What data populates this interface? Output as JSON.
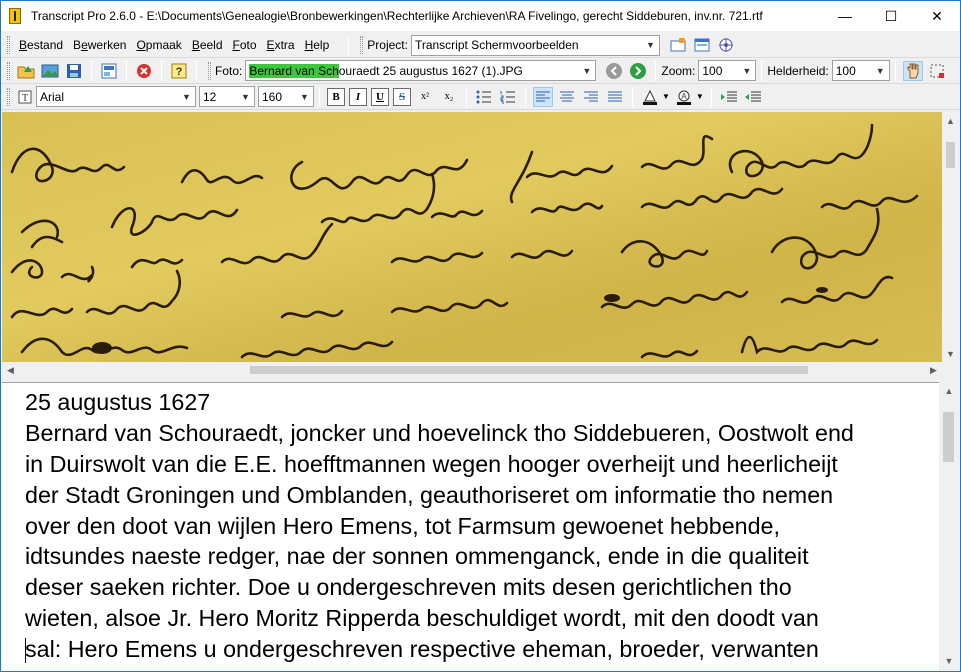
{
  "window": {
    "title": "Transcript Pro 2.6.0 - E:\\Documents\\Genealogie\\Bronbewerkingen\\Rechterlijke Archieven\\RA Fivelingo, gerecht Siddeburen, inv.nr. 721.rtf",
    "controls": {
      "minimize": "—",
      "maximize": "☐",
      "close": "✕"
    }
  },
  "menu": {
    "items": [
      {
        "label": "Bestand",
        "accel": "B"
      },
      {
        "label": "Bewerken",
        "accel": "e"
      },
      {
        "label": "Opmaak",
        "accel": "O"
      },
      {
        "label": "Beeld",
        "accel": "B"
      },
      {
        "label": "Foto",
        "accel": "F"
      },
      {
        "label": "Extra",
        "accel": "E"
      },
      {
        "label": "Help",
        "accel": "H"
      }
    ],
    "project_label": "Project:",
    "project_value": "Transcript Schermvoorbeelden"
  },
  "toolbar": {
    "foto_label": "Foto:",
    "foto_value_highlight": "Bernard van Sch",
    "foto_value_rest": "ouraedt 25 augustus 1627 (1).JPG",
    "zoom_label": "Zoom:",
    "zoom_value": "100",
    "brightness_label": "Helderheid:",
    "brightness_value": "100"
  },
  "format": {
    "font_name": "Arial",
    "font_size": "12",
    "zoom_percent": "160",
    "bold": "B",
    "italic": "I",
    "underline": "U",
    "strike": "S",
    "superscript": "x²",
    "subscript": "x₂"
  },
  "transcript_lines": [
    "25 augustus 1627",
    "Bernard van Schouraedt, joncker und hoevelinck tho Siddebueren, Oostwolt end",
    "in Duirswolt van die E.E. hoefftmannen wegen hooger overheijt und heerlicheijt",
    "der Stadt Groningen und Omblanden, geauthoriseret om informatie tho nemen",
    "over den doot van wijlen Hero Emens, tot Farmsum gewoenet hebbende,",
    "idtsundes naeste redger, nae der sonnen ommenganck, ende in die qualiteit",
    "deser saeken richter. Doe u ondergeschreven mits desen gerichtlichen tho",
    "wieten, alsoe Jr. Hero Moritz Ripperda beschuldiget wordt, mit den doodt van",
    "sal: Hero Emens u ondergeschreven respective eheman, broeder, verwanten"
  ],
  "colors": {
    "accent": "#1979ca",
    "highlight": "#3cc83c",
    "parchment": "#d9c25a",
    "ink": "#2a1d0a"
  }
}
